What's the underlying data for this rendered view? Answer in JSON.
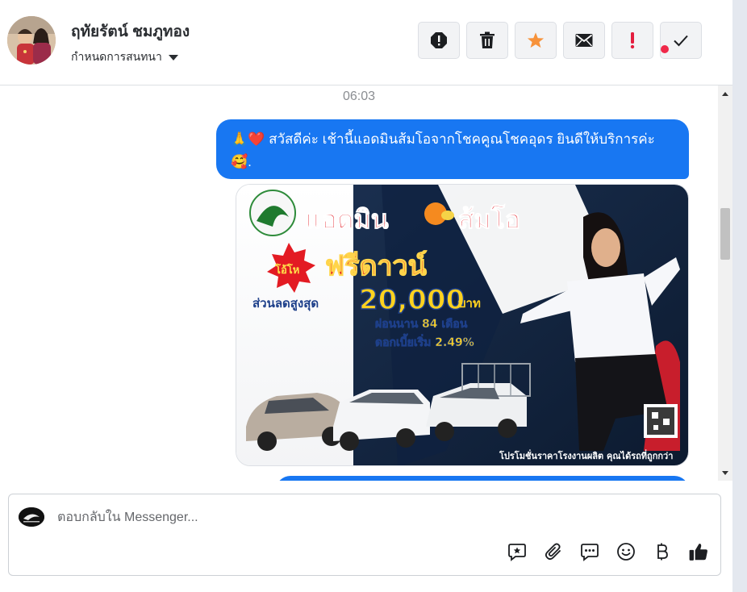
{
  "header": {
    "contact_name": "ฤทัยรัตน์ ชมภูทอง",
    "assign_label": "กำหนดการสนทนา",
    "actions": [
      {
        "name": "spam-icon",
        "color": "#1c1e21"
      },
      {
        "name": "trash-icon",
        "color": "#1c1e21"
      },
      {
        "name": "star-icon",
        "color": "#f7923a"
      },
      {
        "name": "mail-icon",
        "color": "#1c1e21"
      },
      {
        "name": "exclamation-icon",
        "color": "#e41e3f"
      },
      {
        "name": "checkmark-icon",
        "color": "#1c1e21"
      }
    ]
  },
  "conversation": {
    "timestamp": "06:03",
    "message_text": "สวัสดีค่ะ เช้านี้แอดมินส้มโอจากโชคคูณโชคอุดร ยินดีให้บริการค่ะ",
    "message_trailing": ".",
    "message_prefix_emoji": "🙏❤️",
    "message_suffix_emoji": "🥰",
    "promo_image": {
      "headline": "แอดมิน",
      "headline_name": "ส้มโอ",
      "badge": "โอ้โห",
      "offer": "ฟรีดาวน์",
      "discount_label": "ส่วนลดสูงสุด",
      "discount_amount": "20,000",
      "discount_unit": "บาท",
      "installment": "ผ่อนนาน 84 เดือน",
      "interest": "ดอกเบี้ยเริ่ม 2.49%",
      "footer": "โปรโมชั่นราคาโรงงานผลิต คุณได้รถที่ถูกกว่า"
    }
  },
  "composer": {
    "placeholder": "ตอบกลับใน Messenger...",
    "tools": [
      "saved-reply-icon",
      "attachment-icon",
      "chat-bubble-icon",
      "emoji-icon",
      "baht-icon",
      "thumbs-up-icon"
    ],
    "accent": "#1877f2",
    "notification_color": "#f02849"
  }
}
